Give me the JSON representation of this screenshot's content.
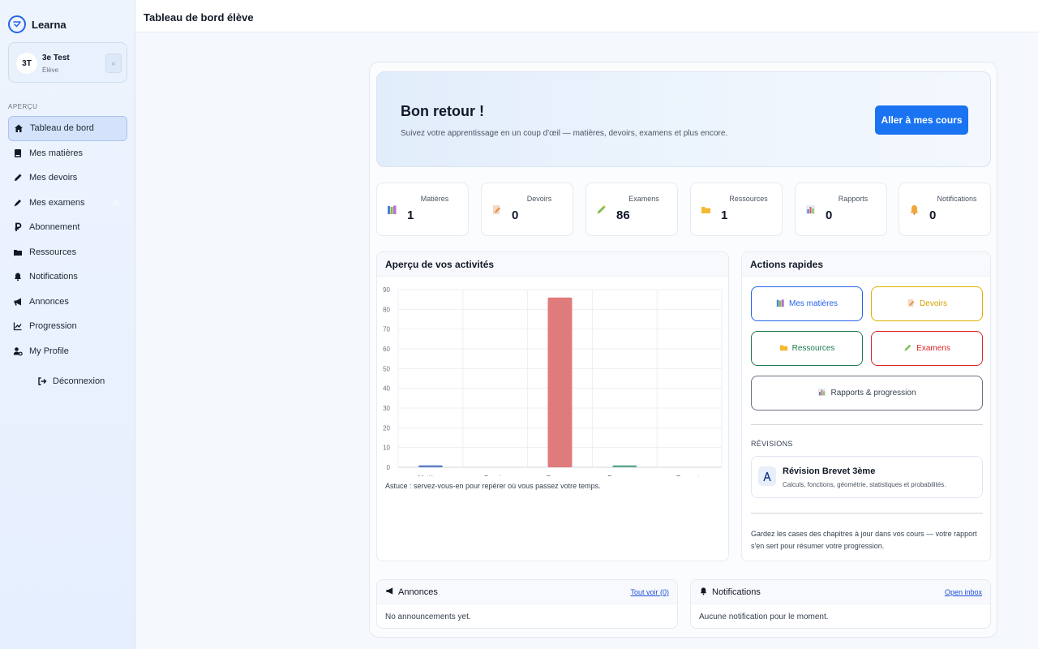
{
  "app": {
    "name": "Learna"
  },
  "user": {
    "initials": "3T",
    "name": "3e Test",
    "role": "Élève",
    "collapse_label": "«"
  },
  "sidebar": {
    "section_label": "APERÇU",
    "items": [
      {
        "label": "Tableau de bord",
        "icon": "home-icon"
      },
      {
        "label": "Mes matières",
        "icon": "book-icon"
      },
      {
        "label": "Mes devoirs",
        "icon": "pencil-icon"
      },
      {
        "label": "Mes examens",
        "icon": "pen-icon"
      },
      {
        "label": "Abonnement",
        "icon": "ruble-icon"
      },
      {
        "label": "Ressources",
        "icon": "folder-icon"
      },
      {
        "label": "Notifications",
        "icon": "bell-icon"
      },
      {
        "label": "Annonces",
        "icon": "megaphone-icon"
      },
      {
        "label": "Progression",
        "icon": "chart-line-icon"
      },
      {
        "label": "My Profile",
        "icon": "user-cog-icon"
      }
    ],
    "logout_label": "Déconnexion"
  },
  "topbar": {
    "title": "Tableau de bord élève"
  },
  "hero": {
    "title": "Bon retour !",
    "subtitle": "Suivez votre apprentissage en un coup d'œil — matières, devoirs, examens et plus encore.",
    "button": "Aller à mes cours"
  },
  "stats": [
    {
      "label": "Matières",
      "value": "1",
      "icon": "books-icon",
      "color": "#4f7fd8"
    },
    {
      "label": "Devoirs",
      "value": "0",
      "icon": "memo-icon",
      "color": "#e98a3e"
    },
    {
      "label": "Examens",
      "value": "86",
      "icon": "pencil-icon",
      "color": "#7cbf4a"
    },
    {
      "label": "Ressources",
      "value": "1",
      "icon": "folder-icon",
      "color": "#f4b930"
    },
    {
      "label": "Rapports",
      "value": "0",
      "icon": "bar-chart-icon",
      "color": "#4b6fc4"
    },
    {
      "label": "Notifications",
      "value": "0",
      "icon": "bell-icon",
      "color": "#f0a73a"
    }
  ],
  "activity": {
    "title": "Aperçu de vos activités",
    "tip": "Astuce : servez-vous-en pour repérer où vous passez votre temps."
  },
  "chart_data": {
    "type": "bar",
    "categories": [
      "Matières",
      "Devoirs",
      "Examens",
      "Ressources",
      "Rapports"
    ],
    "values": [
      1,
      0,
      86,
      1,
      0
    ],
    "colors": [
      "#5b7fc7",
      "#e98a3e",
      "#e07b7b",
      "#5fa98a",
      "#8b7fc7"
    ],
    "ylim": [
      0,
      90
    ],
    "yticks": [
      0,
      10,
      20,
      30,
      40,
      50,
      60,
      70,
      80,
      90
    ],
    "grid": true,
    "title": "",
    "xlabel": "",
    "ylabel": ""
  },
  "quick_actions": {
    "title": "Actions rapides",
    "buttons": [
      {
        "label": "Mes matières",
        "color": "#2563eb"
      },
      {
        "label": "Devoirs",
        "color": "#e0a800"
      },
      {
        "label": "Ressources",
        "color": "#1e7a4f"
      },
      {
        "label": "Examens",
        "color": "#dc2626"
      },
      {
        "label": "Rapports & progression",
        "color": "#4b5563"
      }
    ],
    "revisions_label": "RÉVISIONS",
    "revision": {
      "title": "Révision Brevet 3ème",
      "desc": "Calculs, fonctions, géométrie, statistiques et probabilités."
    },
    "note": "Gardez les cases des chapitres à jour dans vos cours — votre rapport s'en sert pour résumer votre progression."
  },
  "announcements": {
    "title": "Annonces",
    "link": "Tout voir (0)",
    "empty": "No announcements yet."
  },
  "notifications": {
    "title": "Notifications",
    "link": "Open inbox",
    "empty": "Aucune notification pour le moment."
  }
}
